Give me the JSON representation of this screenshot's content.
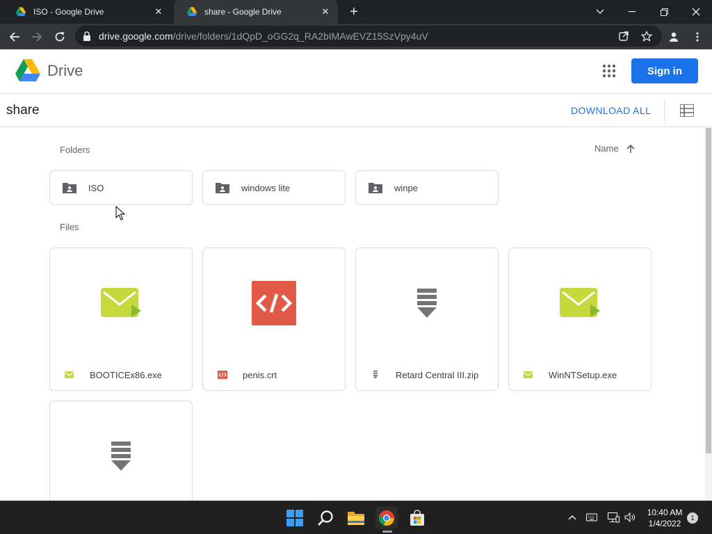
{
  "browser": {
    "tabs": [
      {
        "title": "ISO - Google Drive",
        "active": false
      },
      {
        "title": "share - Google Drive",
        "active": true
      }
    ],
    "url_host": "drive.google.com",
    "url_path": "/drive/folders/1dQpD_oGG2q_RA2bIMAwEVZ15SzVpy4uV"
  },
  "drive": {
    "brand": "Drive",
    "sign_in": "Sign in"
  },
  "sharebar": {
    "title": "share",
    "download_all": "DOWNLOAD ALL"
  },
  "content": {
    "folders_label": "Folders",
    "files_label": "Files",
    "sort_label": "Name",
    "folders": [
      {
        "name": "ISO"
      },
      {
        "name": "windows lite"
      },
      {
        "name": "winpe"
      }
    ],
    "files": [
      {
        "name": "BOOTICEx86.exe",
        "type": "exe"
      },
      {
        "name": "penis.crt",
        "type": "code"
      },
      {
        "name": "Retard Central III.zip",
        "type": "zip"
      },
      {
        "name": "WinNTSetup.exe",
        "type": "exe"
      },
      {
        "name": "",
        "type": "zip"
      }
    ]
  },
  "taskbar": {
    "time": "10:40 AM",
    "date": "1/4/2022",
    "notifications": "1"
  },
  "colors": {
    "brand_blue": "#1a73e8",
    "exe_green": "#c5d93d",
    "code_red": "#e05a47",
    "zip_gray": "#757575"
  }
}
